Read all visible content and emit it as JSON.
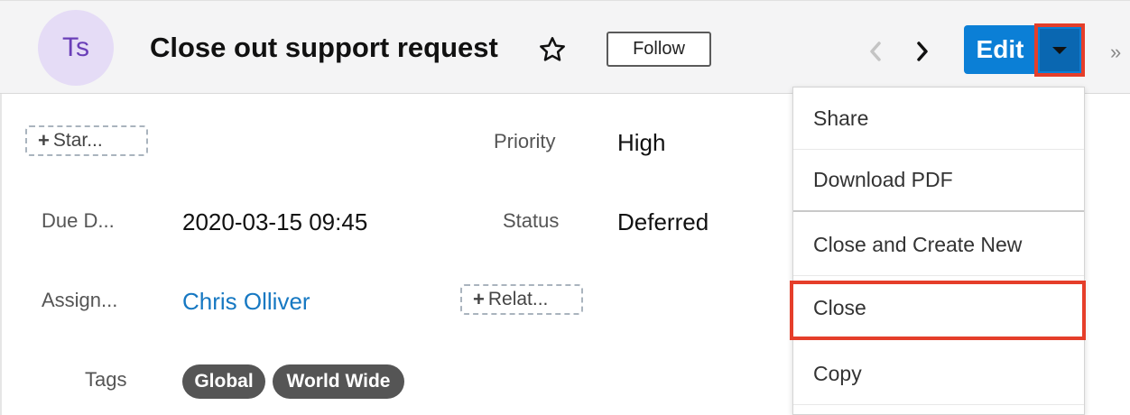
{
  "header": {
    "avatar_initials": "Ts",
    "title": "Close out support request",
    "follow_label": "Follow",
    "edit_label": "Edit"
  },
  "fields": {
    "star_button_label": "Star...",
    "priority_label": "Priority",
    "priority_value": "High",
    "due_date_label": "Due D...",
    "due_date_value": "2020-03-15 09:45",
    "status_label": "Status",
    "status_value": "Deferred",
    "assigned_label": "Assign...",
    "assigned_value": "Chris Olliver",
    "related_button_label": "Relat...",
    "tags_label": "Tags",
    "tags": [
      "Global",
      "World Wide"
    ]
  },
  "menu": {
    "items": [
      "Share",
      "Download PDF",
      "Close and Create New",
      "Close",
      "Copy"
    ]
  },
  "colors": {
    "accent": "#0b7fd6",
    "highlight": "#e53e2a",
    "avatar_bg": "#e5dcf6",
    "tag_bg": "#555555",
    "link": "#1678c2"
  },
  "icons": {
    "star": "star-outline-icon",
    "prev": "chevron-left-icon",
    "next": "chevron-right-icon",
    "caret": "caret-down-icon",
    "more": "double-chevron-right-icon"
  }
}
